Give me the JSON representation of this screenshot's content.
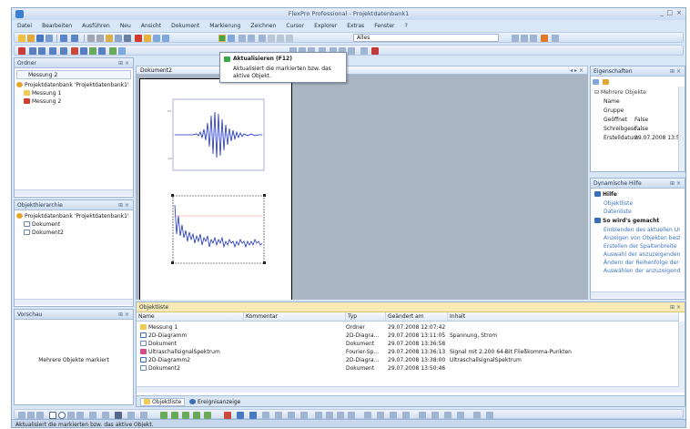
{
  "window": {
    "title": "FlexPro Professional - Projektdatenbank1",
    "controls": [
      "_",
      "□",
      "×"
    ]
  },
  "menu": [
    "Datei",
    "Bearbeiten",
    "Ausführen",
    "Neu",
    "Ansicht",
    "Dokument",
    "Markierung",
    "Zeichnen",
    "Cursor",
    "Explorer",
    "Extras",
    "Fenster",
    "?"
  ],
  "toolbar": {
    "filter_value": "Alles"
  },
  "tooltip": {
    "title": "Aktualisieren (F12)",
    "text": "Aktualisiert die markierten bzw. das aktive Objekt."
  },
  "folder_panel": {
    "title": "Ordner",
    "combo_value": "Messung 2",
    "tree": [
      {
        "label": "Projektdatenbank 'Projektdatenbank1'",
        "level": 0,
        "icon": "database-icon"
      },
      {
        "label": "Messung 1",
        "level": 1,
        "icon": "folder-icon"
      },
      {
        "label": "Messung 2",
        "level": 1,
        "icon": "folder-red-icon"
      }
    ]
  },
  "hierarchy_panel": {
    "title": "Objekthierarchie",
    "tree": [
      {
        "label": "Projektdatenbank 'Projektdatenbank1'",
        "level": 0,
        "icon": "database-icon"
      },
      {
        "label": "Dokument",
        "level": 1,
        "icon": "document-icon"
      },
      {
        "label": "Dokument2",
        "level": 1,
        "icon": "document-icon"
      }
    ]
  },
  "preview_panel": {
    "title": "Vorschau",
    "message": "Mehrere Objekte markiert"
  },
  "document": {
    "tab": "Dokument2"
  },
  "properties_panel": {
    "title": "Eigenschaften",
    "group": "Mehrere Objekte",
    "rows": [
      {
        "name": "Name",
        "value": ""
      },
      {
        "name": "Gruppe",
        "value": ""
      },
      {
        "name": "Geöffnet",
        "value": "False"
      },
      {
        "name": "Schreibgesc...",
        "value": "False"
      },
      {
        "name": "Erstelldatum",
        "value": "29.07.2008 13:5"
      }
    ]
  },
  "help_panel": {
    "title": "Dynamische Hilfe",
    "sections": [
      {
        "heading": "Hilfe",
        "links": [
          "Objektliste",
          "Datenliste"
        ]
      },
      {
        "heading": "So wird's gemacht",
        "links": [
          "Einblenden des aktuellen Ur...",
          "Anzeigen von Objekten bestim...",
          "Erstellen der Spaltenbreite",
          "Auswahl der anzuzeigenden S...",
          "Ändern der Reihenfolge der Sp...",
          "Auswählen der anzuzeigenden..."
        ]
      }
    ]
  },
  "object_list": {
    "title": "Objektliste",
    "columns": [
      "Name",
      "Kommentar",
      "Typ",
      "Geändert am",
      "Inhalt"
    ],
    "rows": [
      {
        "name": "Messung 1",
        "comment": "",
        "type": "Ordner",
        "modified": "29.07.2008 12:07:42",
        "content": "",
        "icon": "folder-icon"
      },
      {
        "name": "2D-Diagramm",
        "comment": "",
        "type": "2D-Diagra...",
        "modified": "29.07.2008 13:11:05",
        "content": "Spannung, Strom",
        "icon": "chart-icon"
      },
      {
        "name": "Dokument",
        "comment": "",
        "type": "Dokument",
        "modified": "29.07.2008 13:36:58",
        "content": "",
        "icon": "document-icon"
      },
      {
        "name": "UltraschallsignalSpektrum",
        "comment": "",
        "type": "Fourier-Sp...",
        "modified": "29.07.2008 13:36:13",
        "content": "Signal mit 2.200 64-Bit Fließkomma-Punkten",
        "icon": "spectrum-icon"
      },
      {
        "name": "2D-Diagramm2",
        "comment": "",
        "type": "2D-Diagra...",
        "modified": "29.07.2008 13:38:00",
        "content": "UltraschallsignalSpektrum",
        "icon": "chart-icon"
      },
      {
        "name": "Dokument2",
        "comment": "",
        "type": "Dokument",
        "modified": "29.07.2008 13:50:46",
        "content": "",
        "icon": "document-icon"
      }
    ],
    "tabs": [
      "Objektliste",
      "Ereignisanzeige"
    ]
  },
  "status": {
    "text": "Aktualisiert die markierten bzw. das aktive Objekt."
  },
  "colors": {
    "frame": "#d9e6f5",
    "workspace": "#abb6c4",
    "signal": "#1a2fd1",
    "objectlist_header": "#f6e9b3"
  }
}
